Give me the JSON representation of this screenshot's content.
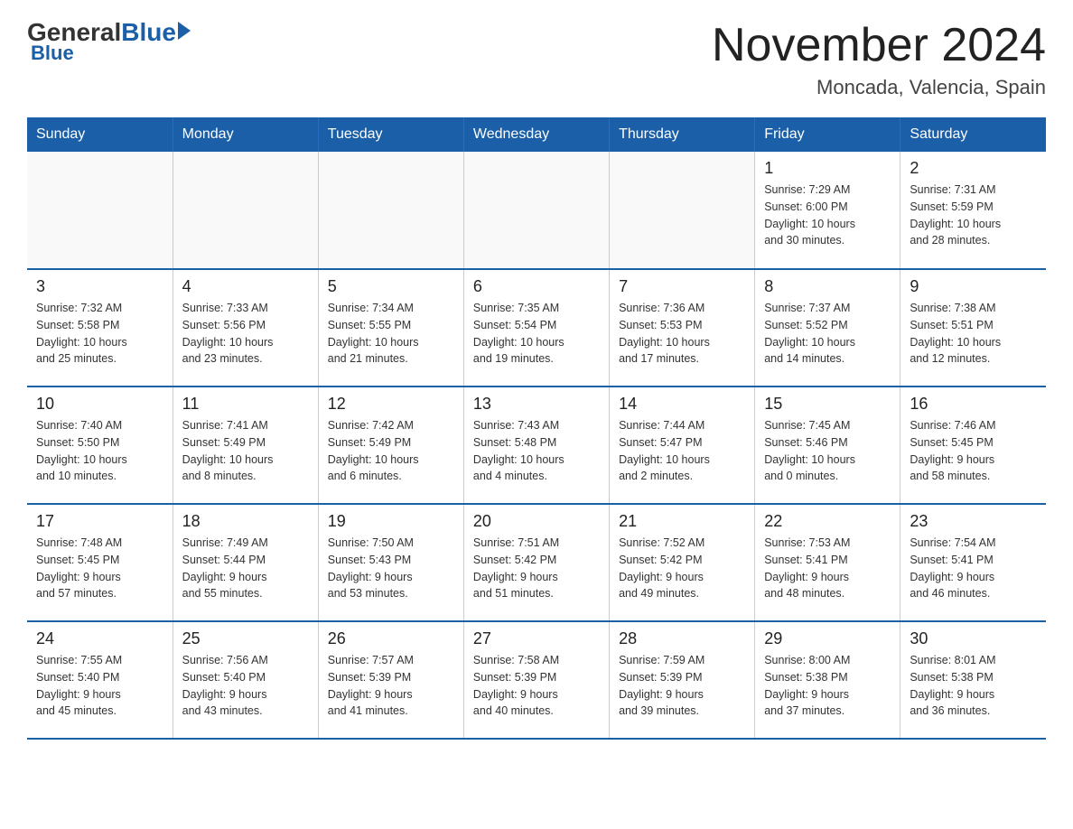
{
  "header": {
    "logo_general": "General",
    "logo_blue": "Blue",
    "month": "November 2024",
    "location": "Moncada, Valencia, Spain"
  },
  "weekdays": [
    "Sunday",
    "Monday",
    "Tuesday",
    "Wednesday",
    "Thursday",
    "Friday",
    "Saturday"
  ],
  "weeks": [
    [
      {
        "day": "",
        "info": ""
      },
      {
        "day": "",
        "info": ""
      },
      {
        "day": "",
        "info": ""
      },
      {
        "day": "",
        "info": ""
      },
      {
        "day": "",
        "info": ""
      },
      {
        "day": "1",
        "info": "Sunrise: 7:29 AM\nSunset: 6:00 PM\nDaylight: 10 hours\nand 30 minutes."
      },
      {
        "day": "2",
        "info": "Sunrise: 7:31 AM\nSunset: 5:59 PM\nDaylight: 10 hours\nand 28 minutes."
      }
    ],
    [
      {
        "day": "3",
        "info": "Sunrise: 7:32 AM\nSunset: 5:58 PM\nDaylight: 10 hours\nand 25 minutes."
      },
      {
        "day": "4",
        "info": "Sunrise: 7:33 AM\nSunset: 5:56 PM\nDaylight: 10 hours\nand 23 minutes."
      },
      {
        "day": "5",
        "info": "Sunrise: 7:34 AM\nSunset: 5:55 PM\nDaylight: 10 hours\nand 21 minutes."
      },
      {
        "day": "6",
        "info": "Sunrise: 7:35 AM\nSunset: 5:54 PM\nDaylight: 10 hours\nand 19 minutes."
      },
      {
        "day": "7",
        "info": "Sunrise: 7:36 AM\nSunset: 5:53 PM\nDaylight: 10 hours\nand 17 minutes."
      },
      {
        "day": "8",
        "info": "Sunrise: 7:37 AM\nSunset: 5:52 PM\nDaylight: 10 hours\nand 14 minutes."
      },
      {
        "day": "9",
        "info": "Sunrise: 7:38 AM\nSunset: 5:51 PM\nDaylight: 10 hours\nand 12 minutes."
      }
    ],
    [
      {
        "day": "10",
        "info": "Sunrise: 7:40 AM\nSunset: 5:50 PM\nDaylight: 10 hours\nand 10 minutes."
      },
      {
        "day": "11",
        "info": "Sunrise: 7:41 AM\nSunset: 5:49 PM\nDaylight: 10 hours\nand 8 minutes."
      },
      {
        "day": "12",
        "info": "Sunrise: 7:42 AM\nSunset: 5:49 PM\nDaylight: 10 hours\nand 6 minutes."
      },
      {
        "day": "13",
        "info": "Sunrise: 7:43 AM\nSunset: 5:48 PM\nDaylight: 10 hours\nand 4 minutes."
      },
      {
        "day": "14",
        "info": "Sunrise: 7:44 AM\nSunset: 5:47 PM\nDaylight: 10 hours\nand 2 minutes."
      },
      {
        "day": "15",
        "info": "Sunrise: 7:45 AM\nSunset: 5:46 PM\nDaylight: 10 hours\nand 0 minutes."
      },
      {
        "day": "16",
        "info": "Sunrise: 7:46 AM\nSunset: 5:45 PM\nDaylight: 9 hours\nand 58 minutes."
      }
    ],
    [
      {
        "day": "17",
        "info": "Sunrise: 7:48 AM\nSunset: 5:45 PM\nDaylight: 9 hours\nand 57 minutes."
      },
      {
        "day": "18",
        "info": "Sunrise: 7:49 AM\nSunset: 5:44 PM\nDaylight: 9 hours\nand 55 minutes."
      },
      {
        "day": "19",
        "info": "Sunrise: 7:50 AM\nSunset: 5:43 PM\nDaylight: 9 hours\nand 53 minutes."
      },
      {
        "day": "20",
        "info": "Sunrise: 7:51 AM\nSunset: 5:42 PM\nDaylight: 9 hours\nand 51 minutes."
      },
      {
        "day": "21",
        "info": "Sunrise: 7:52 AM\nSunset: 5:42 PM\nDaylight: 9 hours\nand 49 minutes."
      },
      {
        "day": "22",
        "info": "Sunrise: 7:53 AM\nSunset: 5:41 PM\nDaylight: 9 hours\nand 48 minutes."
      },
      {
        "day": "23",
        "info": "Sunrise: 7:54 AM\nSunset: 5:41 PM\nDaylight: 9 hours\nand 46 minutes."
      }
    ],
    [
      {
        "day": "24",
        "info": "Sunrise: 7:55 AM\nSunset: 5:40 PM\nDaylight: 9 hours\nand 45 minutes."
      },
      {
        "day": "25",
        "info": "Sunrise: 7:56 AM\nSunset: 5:40 PM\nDaylight: 9 hours\nand 43 minutes."
      },
      {
        "day": "26",
        "info": "Sunrise: 7:57 AM\nSunset: 5:39 PM\nDaylight: 9 hours\nand 41 minutes."
      },
      {
        "day": "27",
        "info": "Sunrise: 7:58 AM\nSunset: 5:39 PM\nDaylight: 9 hours\nand 40 minutes."
      },
      {
        "day": "28",
        "info": "Sunrise: 7:59 AM\nSunset: 5:39 PM\nDaylight: 9 hours\nand 39 minutes."
      },
      {
        "day": "29",
        "info": "Sunrise: 8:00 AM\nSunset: 5:38 PM\nDaylight: 9 hours\nand 37 minutes."
      },
      {
        "day": "30",
        "info": "Sunrise: 8:01 AM\nSunset: 5:38 PM\nDaylight: 9 hours\nand 36 minutes."
      }
    ]
  ]
}
